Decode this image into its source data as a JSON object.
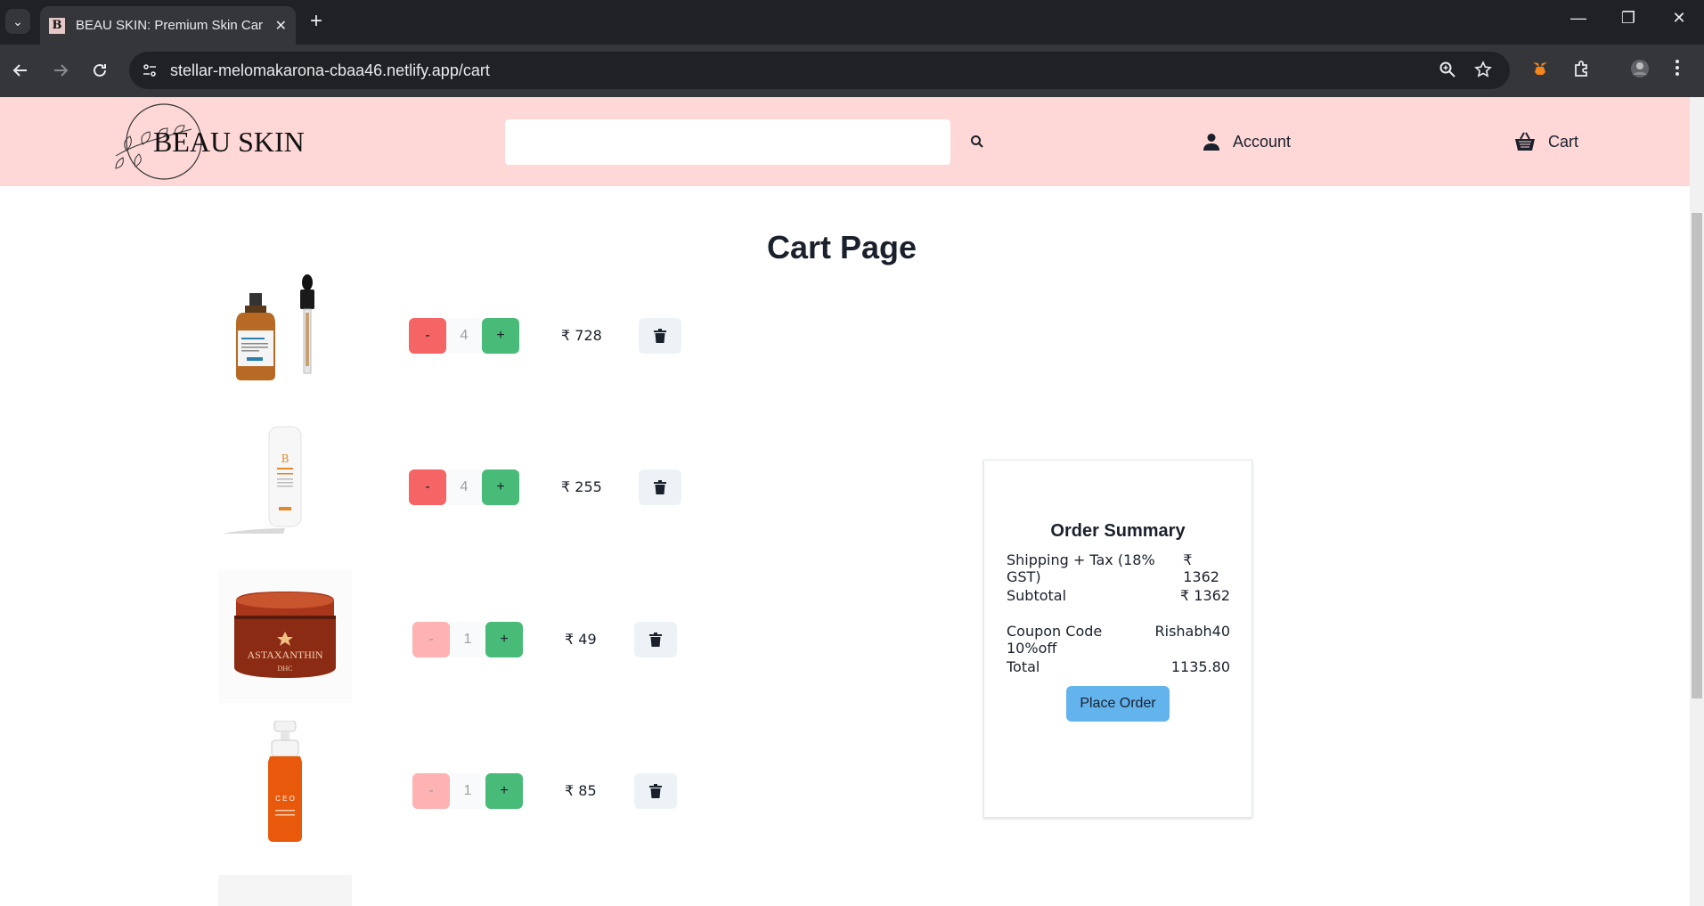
{
  "browser": {
    "tab_title": "BEAU SKIN: Premium Skin Care",
    "favicon_letter": "B",
    "url": "stellar-melomakarona-cbaa46.netlify.app/cart",
    "new_tab": "+",
    "tab_close": "✕",
    "minimize": "—",
    "restore": "❐",
    "close": "✕"
  },
  "header": {
    "logo_text": "BEAU SKIN",
    "search_placeholder": "",
    "account_label": "Account",
    "cart_label": "Cart"
  },
  "main": {
    "title": "Cart Page",
    "items": [
      {
        "quantity": "4",
        "price": "₹ 728",
        "decrement": "-",
        "increment": "+",
        "decrement_disabled": false
      },
      {
        "quantity": "4",
        "price": "₹ 255",
        "decrement": "-",
        "increment": "+",
        "decrement_disabled": false
      },
      {
        "quantity": "1",
        "price": "₹ 49",
        "decrement": "-",
        "increment": "+",
        "decrement_disabled": true
      },
      {
        "quantity": "1",
        "price": "₹ 85",
        "decrement": "-",
        "increment": "+",
        "decrement_disabled": true
      }
    ]
  },
  "summary": {
    "title": "Order Summary",
    "shipping_label": "Shipping + Tax (18% GST)",
    "shipping_value": "₹ 1362",
    "subtotal_label": "Subtotal",
    "subtotal_value": "₹ 1362",
    "coupon_label": "Coupon Code 10%off",
    "coupon_value": "Rishabh40",
    "total_label": "Total",
    "total_value": "1135.80",
    "place_order_label": "Place Order"
  },
  "colors": {
    "header_bg": "#fed7d7",
    "decrement": "#f56565",
    "increment": "#48bb78",
    "place_order": "#63b3ed"
  }
}
